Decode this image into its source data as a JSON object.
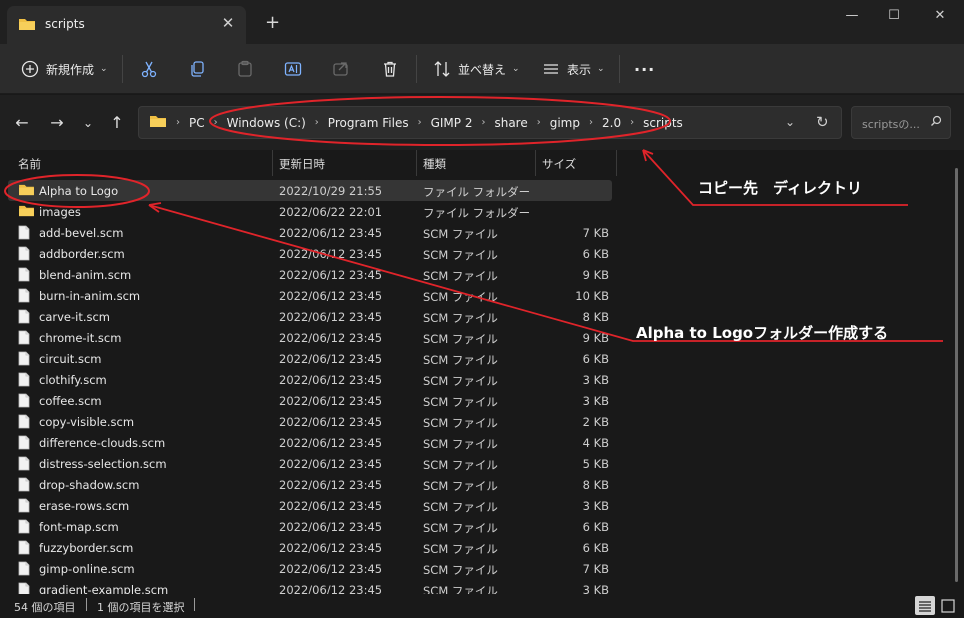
{
  "window": {
    "tab_title": "scripts",
    "tab_close": "✕",
    "new_tab": "+",
    "minimize": "—",
    "maximize": "☐",
    "close": "✕"
  },
  "toolbar": {
    "new_label": "新規作成",
    "sort_label": "並べ替え",
    "view_label": "表示",
    "more": "···"
  },
  "address": {
    "crumbs": [
      "PC",
      "Windows (C:)",
      "Program Files",
      "GIMP 2",
      "share",
      "gimp",
      "2.0",
      "scripts"
    ],
    "search_placeholder": "scriptsの..."
  },
  "columns": {
    "name": "名前",
    "date": "更新日時",
    "type": "種類",
    "size": "サイズ"
  },
  "files": [
    {
      "name": "Alpha to Logo",
      "date": "2022/10/29 21:55",
      "type": "ファイル フォルダー",
      "size": "",
      "kind": "folder",
      "selected": true
    },
    {
      "name": "images",
      "date": "2022/06/22 22:01",
      "type": "ファイル フォルダー",
      "size": "",
      "kind": "folder",
      "selected": false
    },
    {
      "name": "add-bevel.scm",
      "date": "2022/06/12 23:45",
      "type": "SCM ファイル",
      "size": "7 KB",
      "kind": "file",
      "selected": false
    },
    {
      "name": "addborder.scm",
      "date": "2022/06/12 23:45",
      "type": "SCM ファイル",
      "size": "6 KB",
      "kind": "file",
      "selected": false
    },
    {
      "name": "blend-anim.scm",
      "date": "2022/06/12 23:45",
      "type": "SCM ファイル",
      "size": "9 KB",
      "kind": "file",
      "selected": false
    },
    {
      "name": "burn-in-anim.scm",
      "date": "2022/06/12 23:45",
      "type": "SCM ファイル",
      "size": "10 KB",
      "kind": "file",
      "selected": false
    },
    {
      "name": "carve-it.scm",
      "date": "2022/06/12 23:45",
      "type": "SCM ファイル",
      "size": "8 KB",
      "kind": "file",
      "selected": false
    },
    {
      "name": "chrome-it.scm",
      "date": "2022/06/12 23:45",
      "type": "SCM ファイル",
      "size": "9 KB",
      "kind": "file",
      "selected": false
    },
    {
      "name": "circuit.scm",
      "date": "2022/06/12 23:45",
      "type": "SCM ファイル",
      "size": "6 KB",
      "kind": "file",
      "selected": false
    },
    {
      "name": "clothify.scm",
      "date": "2022/06/12 23:45",
      "type": "SCM ファイル",
      "size": "3 KB",
      "kind": "file",
      "selected": false
    },
    {
      "name": "coffee.scm",
      "date": "2022/06/12 23:45",
      "type": "SCM ファイル",
      "size": "3 KB",
      "kind": "file",
      "selected": false
    },
    {
      "name": "copy-visible.scm",
      "date": "2022/06/12 23:45",
      "type": "SCM ファイル",
      "size": "2 KB",
      "kind": "file",
      "selected": false
    },
    {
      "name": "difference-clouds.scm",
      "date": "2022/06/12 23:45",
      "type": "SCM ファイル",
      "size": "4 KB",
      "kind": "file",
      "selected": false
    },
    {
      "name": "distress-selection.scm",
      "date": "2022/06/12 23:45",
      "type": "SCM ファイル",
      "size": "5 KB",
      "kind": "file",
      "selected": false
    },
    {
      "name": "drop-shadow.scm",
      "date": "2022/06/12 23:45",
      "type": "SCM ファイル",
      "size": "8 KB",
      "kind": "file",
      "selected": false
    },
    {
      "name": "erase-rows.scm",
      "date": "2022/06/12 23:45",
      "type": "SCM ファイル",
      "size": "3 KB",
      "kind": "file",
      "selected": false
    },
    {
      "name": "font-map.scm",
      "date": "2022/06/12 23:45",
      "type": "SCM ファイル",
      "size": "6 KB",
      "kind": "file",
      "selected": false
    },
    {
      "name": "fuzzyborder.scm",
      "date": "2022/06/12 23:45",
      "type": "SCM ファイル",
      "size": "6 KB",
      "kind": "file",
      "selected": false
    },
    {
      "name": "gimp-online.scm",
      "date": "2022/06/12 23:45",
      "type": "SCM ファイル",
      "size": "7 KB",
      "kind": "file",
      "selected": false
    },
    {
      "name": "gradient-example.scm",
      "date": "2022/06/12 23:45",
      "type": "SCM ファイル",
      "size": "3 KB",
      "kind": "file",
      "selected": false
    }
  ],
  "status": {
    "count": "54 個の項目",
    "selected": "1 個の項目を選択"
  },
  "annotations": {
    "dest_label": "コピー先　ディレクトリ",
    "create_label": "Alpha to Logoフォルダー作成する",
    "color": "#e0242a"
  },
  "colors": {
    "folder": "#f0c044",
    "accent_red": "#e0242a"
  }
}
